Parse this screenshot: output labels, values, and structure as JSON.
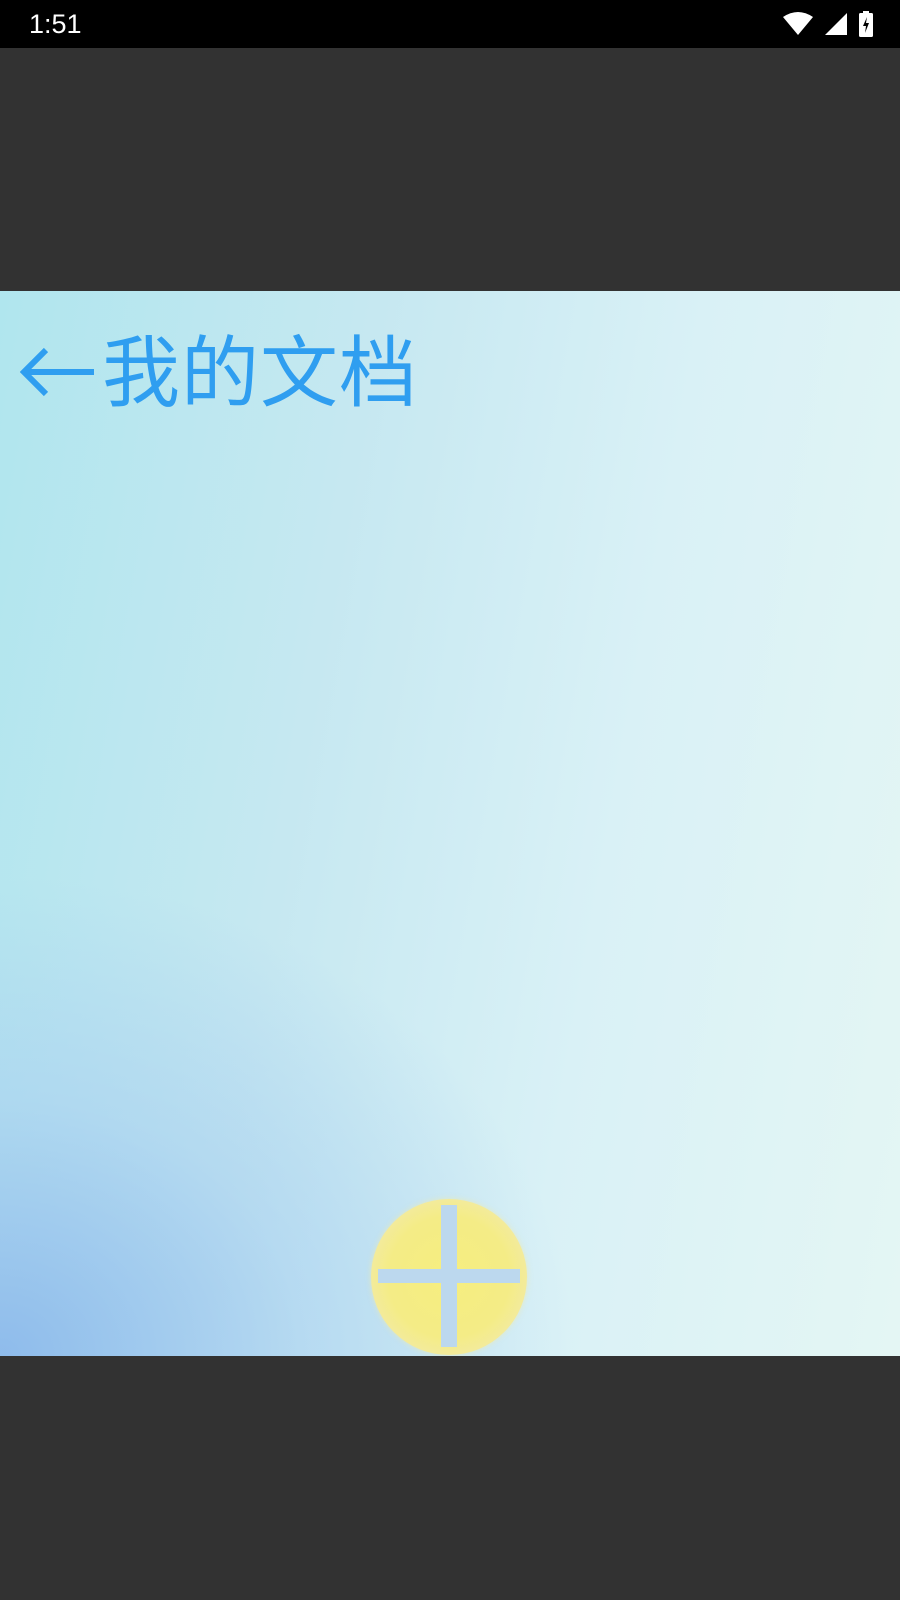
{
  "status_bar": {
    "time": "1:51",
    "icons": [
      "wifi-icon",
      "cellular-signal-icon",
      "battery-charging-icon"
    ]
  },
  "header": {
    "back_icon": "back-arrow-icon",
    "title": "我的文档"
  },
  "fab": {
    "icon": "plus-icon"
  },
  "colors": {
    "title": "#2f9ef0",
    "fab": "#f4ec86",
    "letterbox": "#323232",
    "status_bar": "#000000"
  }
}
